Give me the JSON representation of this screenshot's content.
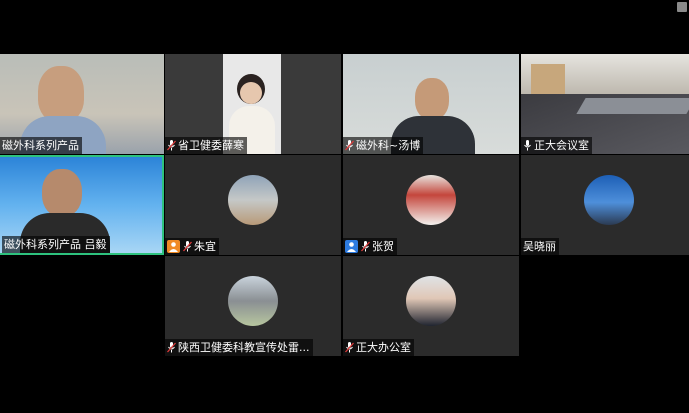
{
  "participants": [
    {
      "name": "磁外科系列产品",
      "type": "video",
      "muted": false,
      "has_mic": false
    },
    {
      "name": "省卫健委薛寒",
      "type": "video",
      "muted": true,
      "has_mic": true
    },
    {
      "name": "磁外科~汤博",
      "type": "video",
      "muted": true,
      "has_mic": true
    },
    {
      "name": "正大会议室",
      "type": "video",
      "muted": false,
      "has_mic": true
    },
    {
      "name": "磁外科系列产品 吕毅",
      "type": "video",
      "muted": false,
      "has_mic": false
    },
    {
      "name": "朱宜",
      "type": "avatar",
      "muted": true,
      "has_mic": true
    },
    {
      "name": "张贺",
      "type": "avatar",
      "muted": true,
      "has_mic": true
    },
    {
      "name": "吴晓丽",
      "type": "avatar",
      "muted": false,
      "has_mic": false
    },
    {
      "name": "陕西卫健委科教宣传处雷...",
      "type": "avatar",
      "muted": true,
      "has_mic": true
    },
    {
      "name": "正大办公室",
      "type": "avatar",
      "muted": true,
      "has_mic": true
    }
  ]
}
